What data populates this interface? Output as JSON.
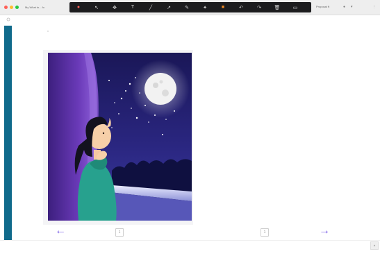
{
  "browser": {
    "tab_title": "My What to... fo",
    "right_text": "Proposal ft",
    "traffic_lights": [
      "#ff5f57",
      "#febc2e",
      "#28c840"
    ]
  },
  "toolbar": {
    "tools": [
      {
        "name": "record-icon",
        "glyph": "●"
      },
      {
        "name": "cursor-icon",
        "glyph": "↖"
      },
      {
        "name": "move-icon",
        "glyph": "✥"
      },
      {
        "name": "text-icon",
        "glyph": "T"
      },
      {
        "name": "line-icon",
        "glyph": "╱"
      },
      {
        "name": "arrow-icon",
        "glyph": "↗"
      },
      {
        "name": "pen-icon",
        "glyph": "✎"
      },
      {
        "name": "highlight-icon",
        "glyph": "✦"
      },
      {
        "name": "color-swatch-icon",
        "glyph": "■"
      },
      {
        "name": "undo-icon",
        "glyph": "↶"
      },
      {
        "name": "redo-icon",
        "glyph": "↷"
      },
      {
        "name": "trash-icon",
        "glyph": "🗑"
      },
      {
        "name": "screen-icon",
        "glyph": "▭"
      }
    ],
    "accent": "#f08a24"
  },
  "book": {
    "page_left": "1",
    "page_right": "1",
    "prev_glyph": "←",
    "next_glyph": "→",
    "accent": "#7a5ee6",
    "sidebar_color": "#106a8b"
  }
}
